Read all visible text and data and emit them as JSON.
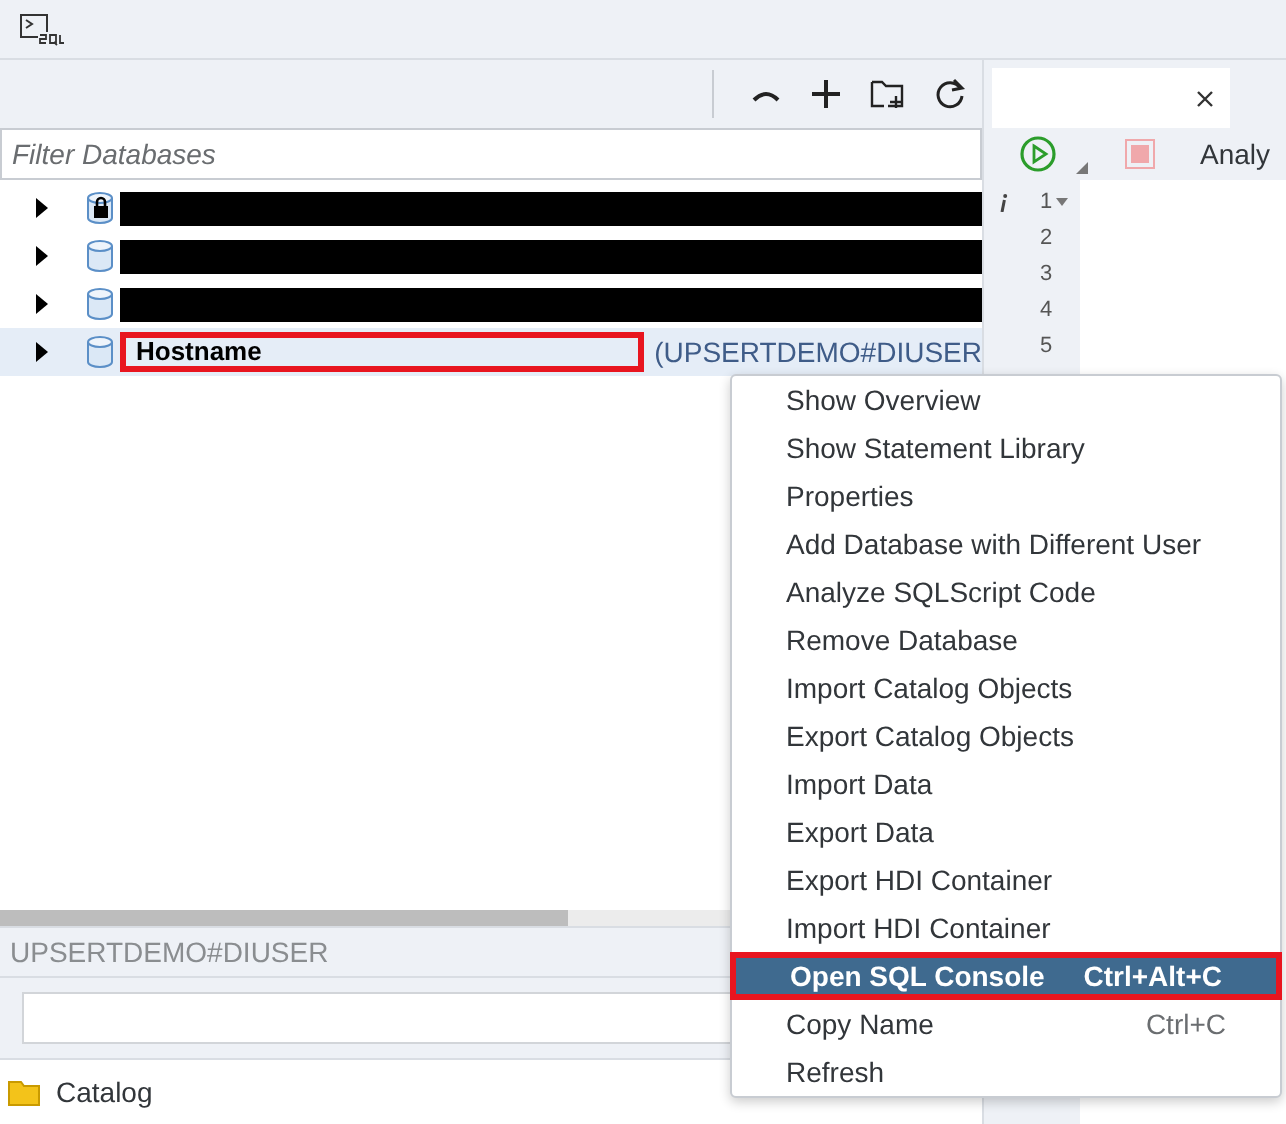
{
  "filter": {
    "placeholder": "Filter Databases"
  },
  "tree": [
    {
      "redacted": true,
      "locked": true,
      "selected": false,
      "annotated": false
    },
    {
      "redacted": true,
      "locked": false,
      "selected": false,
      "annotated": false
    },
    {
      "redacted": true,
      "locked": false,
      "selected": false,
      "annotated": false
    },
    {
      "label": "Hostname",
      "suffix": "(UPSERTDEMO#DIUSER",
      "redacted": false,
      "locked": false,
      "selected": true,
      "annotated": true
    }
  ],
  "details": {
    "title": "UPSERTDEMO#DIUSER",
    "catalog": "Catalog"
  },
  "editor": {
    "toolbar_text": "Analy",
    "line_numbers": [
      "1",
      "2",
      "3",
      "4",
      "5"
    ]
  },
  "context_menu": [
    {
      "label": "Show Overview",
      "selected": false,
      "annotated": false
    },
    {
      "label": "Show Statement Library",
      "selected": false,
      "annotated": false
    },
    {
      "label": "Properties",
      "selected": false,
      "annotated": false
    },
    {
      "label": "Add Database with Different User",
      "selected": false,
      "annotated": false
    },
    {
      "label": "Analyze SQLScript Code",
      "selected": false,
      "annotated": false
    },
    {
      "label": "Remove Database",
      "selected": false,
      "annotated": false
    },
    {
      "label": "Import Catalog Objects",
      "selected": false,
      "annotated": false
    },
    {
      "label": "Export Catalog Objects",
      "selected": false,
      "annotated": false
    },
    {
      "label": "Import Data",
      "selected": false,
      "annotated": false
    },
    {
      "label": "Export Data",
      "selected": false,
      "annotated": false
    },
    {
      "label": "Export HDI Container",
      "selected": false,
      "annotated": false
    },
    {
      "label": "Import HDI Container",
      "selected": false,
      "annotated": false
    },
    {
      "label": "Open SQL Console",
      "shortcut": "Ctrl+Alt+C",
      "selected": true,
      "annotated": true
    },
    {
      "label": "Copy Name",
      "shortcut": "Ctrl+C",
      "selected": false,
      "annotated": false
    },
    {
      "label": "Refresh",
      "selected": false,
      "annotated": false
    }
  ]
}
